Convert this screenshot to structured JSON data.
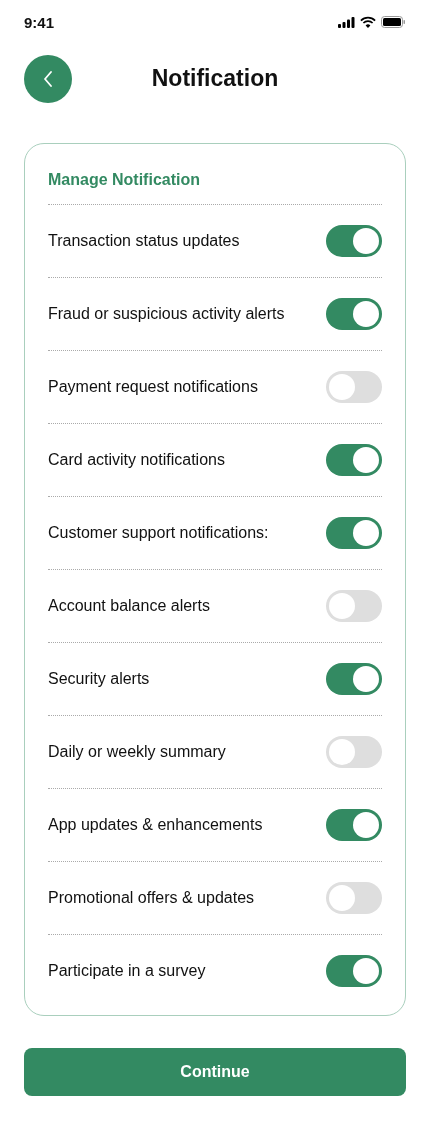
{
  "status_bar": {
    "time": "9:41"
  },
  "header": {
    "title": "Notification"
  },
  "card": {
    "title": "Manage Notification",
    "settings": [
      {
        "label": "Transaction status updates",
        "on": true
      },
      {
        "label": "Fraud or suspicious activity alerts",
        "on": true
      },
      {
        "label": "Payment request notifications",
        "on": false
      },
      {
        "label": "Card activity notifications",
        "on": true
      },
      {
        "label": "Customer support notifications:",
        "on": true
      },
      {
        "label": "Account balance alerts",
        "on": false
      },
      {
        "label": "Security alerts",
        "on": true
      },
      {
        "label": "Daily or weekly summary",
        "on": false
      },
      {
        "label": "App updates & enhancements",
        "on": true
      },
      {
        "label": "Promotional offers & updates",
        "on": false
      },
      {
        "label": "Participate in a survey",
        "on": true
      }
    ]
  },
  "buttons": [
    "Continue"
  ]
}
